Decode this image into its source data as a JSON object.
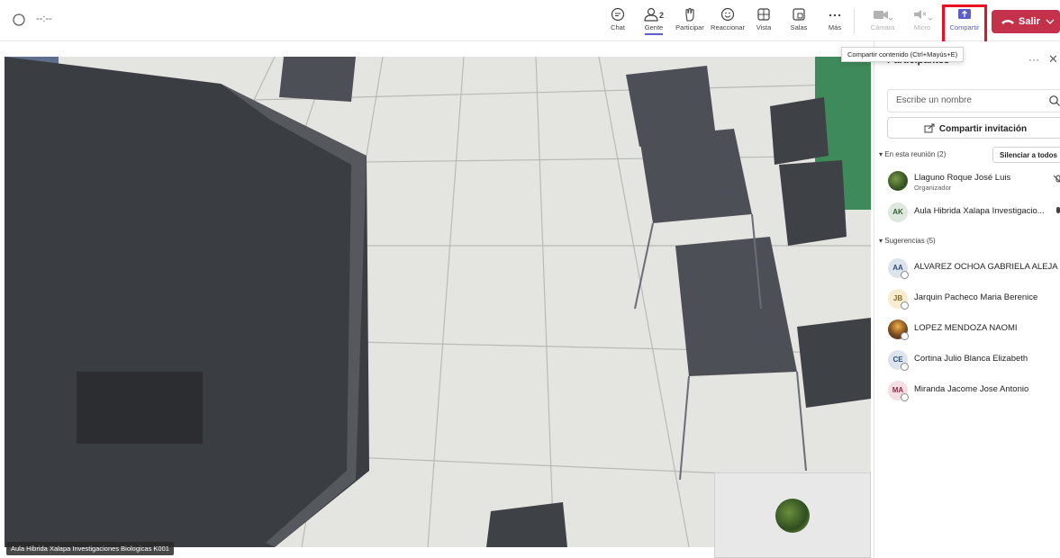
{
  "header": {
    "timer": "--:--",
    "tools": [
      {
        "label": "Chat",
        "icon": "chat-icon"
      },
      {
        "label": "Gente",
        "icon": "people-icon",
        "badge": "2"
      },
      {
        "label": "Participar",
        "icon": "raise-hand-icon"
      },
      {
        "label": "Reaccionar",
        "icon": "smiley-icon"
      },
      {
        "label": "Vista",
        "icon": "grid-view-icon"
      },
      {
        "label": "Salas",
        "icon": "breakout-rooms-icon"
      },
      {
        "label": "Más",
        "icon": "more-icon"
      },
      {
        "label": "Cámara",
        "icon": "camera-off-icon"
      },
      {
        "label": "Micro",
        "icon": "mic-off-icon"
      },
      {
        "label": "Compartir",
        "icon": "share-icon"
      }
    ],
    "leave_label": "Salir",
    "share_tooltip": "Compartir contenido (Ctrl+Mayús+E)"
  },
  "video": {
    "label": "Aula Hibrida Xalapa Investigaciones Biologicas K001"
  },
  "panel": {
    "title": "Participantes",
    "search_placeholder": "Escribe un nombre",
    "invite_label": "Compartir invitación",
    "in_meeting_label": "En esta reunión (2)",
    "mute_all_label": "Silenciar a todos",
    "in_meeting": [
      {
        "initials": "",
        "name": "Llaguno Roque José Luis",
        "role": "Organizador"
      },
      {
        "initials": "AK",
        "name": "Aula Hibrida Xalapa Investigacio...",
        "role": ""
      }
    ],
    "suggestions_label": "Sugerencias (5)",
    "suggestions": [
      {
        "initials": "AA",
        "name": "ALVAREZ OCHOA GABRIELA ALEJAN..."
      },
      {
        "initials": "JB",
        "name": "Jarquin Pacheco Maria Berenice"
      },
      {
        "initials": "",
        "name": "LOPEZ MENDOZA NAOMI"
      },
      {
        "initials": "CE",
        "name": "Cortina Julio Blanca Elizabeth"
      },
      {
        "initials": "MA",
        "name": "Miranda Jacome Jose Antonio"
      }
    ]
  },
  "colors": {
    "accent": "#5b5fc7",
    "leave": "#c4314b",
    "highlight_box": "#e81123"
  }
}
